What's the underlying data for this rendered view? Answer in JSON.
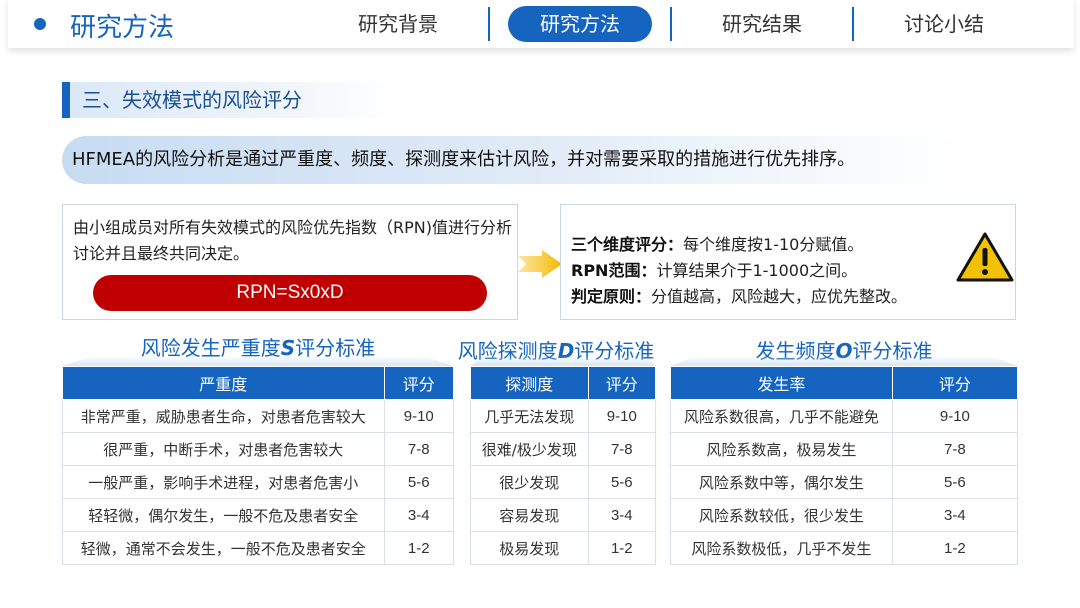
{
  "header": {
    "title": "研究方法",
    "tabs": [
      {
        "label": "研究背景",
        "active": false
      },
      {
        "label": "研究方法",
        "active": true
      },
      {
        "label": "研究结果",
        "active": false
      },
      {
        "label": "讨论小结",
        "active": false
      }
    ]
  },
  "section": {
    "title": "三、失效模式的风险评分"
  },
  "intro": "HFMEA的风险分析是通过严重度、频度、探测度来估计风险，并对需要采取的措施进行优先排序。",
  "left_box": {
    "text": "由小组成员对所有失效模式的风险优先指数（RPN)值进行分析讨论并且最终共同决定。",
    "formula": "RPN=Sx0xD"
  },
  "right_box": {
    "lines": [
      {
        "label": "三个维度评分：",
        "text": "每个维度按1-10分赋值。"
      },
      {
        "label": "RPN范围：",
        "text": "计算结果介于1-1000之间。"
      },
      {
        "label": "判定原则：",
        "text": "分值越高，风险越大，应优先整改。"
      }
    ],
    "icon": "warning-icon"
  },
  "tables": {
    "severity": {
      "caption_pre": "风险发生严重度",
      "caption_hl": "S",
      "caption_post": "评分标准",
      "headers": [
        "严重度",
        "评分"
      ],
      "rows": [
        [
          "非常严重，威胁患者生命，对患者危害较大",
          "9-10"
        ],
        [
          "很严重，中断手术，对患者危害较大",
          "7-8"
        ],
        [
          "一般严重，影响手术进程，对患者危害小",
          "5-6"
        ],
        [
          "轻轻微，偶尔发生，一般不危及患者安全",
          "3-4"
        ],
        [
          "轻微，通常不会发生，一般不危及患者安全",
          "1-2"
        ]
      ]
    },
    "detection": {
      "caption_pre": "风险探测度",
      "caption_hl": "D",
      "caption_post": "评分标准",
      "headers": [
        "探测度",
        "评分"
      ],
      "rows": [
        [
          "几乎无法发现",
          "9-10"
        ],
        [
          "很难/极少发现",
          "7-8"
        ],
        [
          "很少发现",
          "5-6"
        ],
        [
          "容易发现",
          "3-4"
        ],
        [
          "极易发现",
          "1-2"
        ]
      ]
    },
    "occurrence": {
      "caption_pre": "发生频度",
      "caption_hl": "O",
      "caption_post": "评分标准",
      "headers": [
        "发生率",
        "评分"
      ],
      "rows": [
        [
          "风险系数很高，几乎不能避免",
          "9-10"
        ],
        [
          "风险系数高，极易发生",
          "7-8"
        ],
        [
          "风险系数中等，偶尔发生",
          "5-6"
        ],
        [
          "风险系数较低，很少发生",
          "3-4"
        ],
        [
          "风险系数极低，几乎不发生",
          "1-2"
        ]
      ]
    }
  },
  "colors": {
    "accent": "#1565c0",
    "formula_bg": "#c00000",
    "warning": "#f2c200"
  }
}
